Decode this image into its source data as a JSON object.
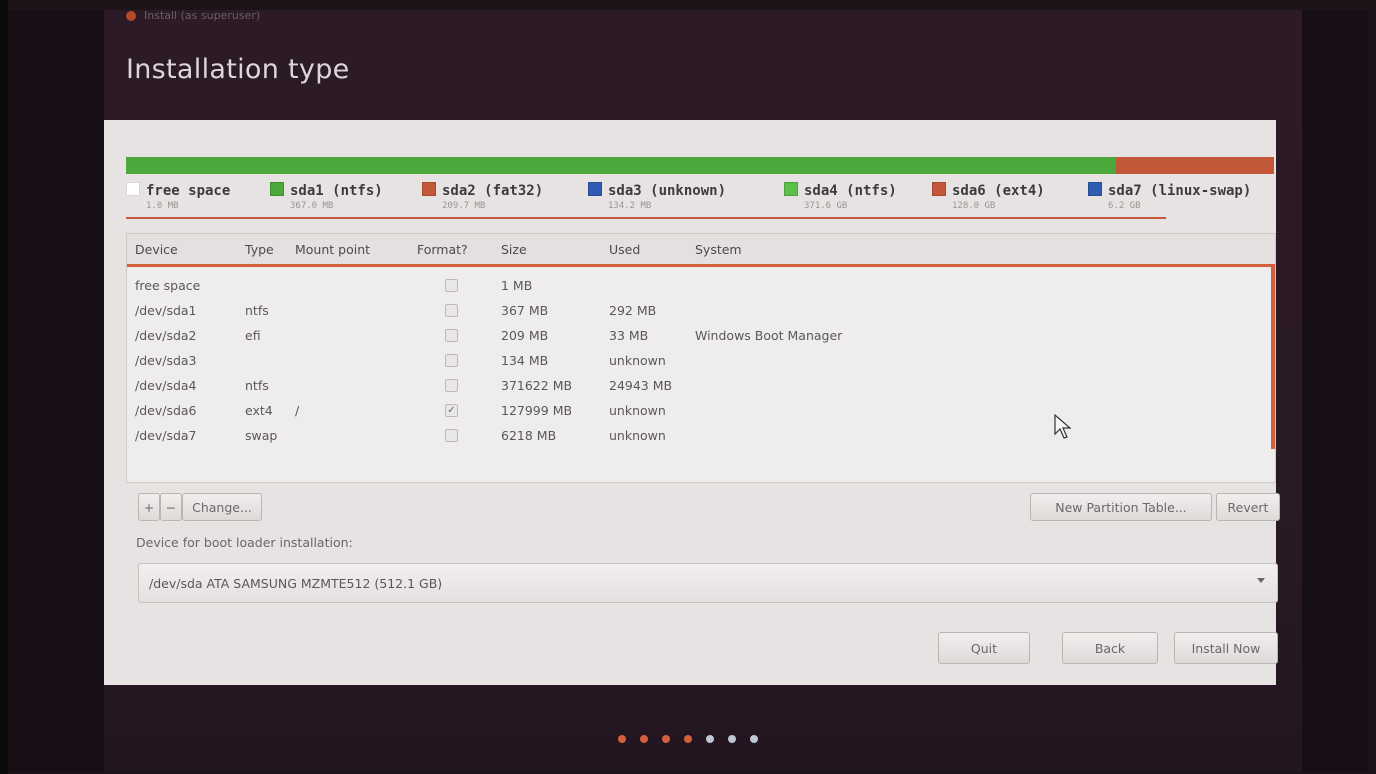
{
  "window": {
    "title": "Install (as superuser)"
  },
  "page": {
    "title": "Installation type"
  },
  "usage_bar": {
    "segments": [
      {
        "name": "sda1",
        "color": "#4aa93a",
        "share": 0.001
      },
      {
        "name": "sda2",
        "color": "#4aa93a",
        "share": 0.001
      },
      {
        "name": "sda4",
        "color": "#4aa93a",
        "share": 0.86
      },
      {
        "name": "sda6",
        "color": "#c4583a",
        "share": 0.128
      },
      {
        "name": "sda7",
        "color": "#c4583a",
        "share": 0.01
      }
    ]
  },
  "legend": [
    {
      "label": "free space",
      "size": "1.0 MB",
      "color": "#ffffff"
    },
    {
      "label": "sda1 (ntfs)",
      "size": "367.0 MB",
      "color": "#4aa93a"
    },
    {
      "label": "sda2 (fat32)",
      "size": "209.7 MB",
      "color": "#c4583a"
    },
    {
      "label": "sda3 (unknown)",
      "size": "134.2 MB",
      "color": "#2f5bb0"
    },
    {
      "label": "sda4 (ntfs)",
      "size": "371.6 GB",
      "color": "#5ac04a"
    },
    {
      "label": "sda6 (ext4)",
      "size": "128.0 GB",
      "color": "#c4583a"
    },
    {
      "label": "sda7 (linux-swap)",
      "size": "6.2 GB",
      "color": "#2f5bb0"
    }
  ],
  "table": {
    "headers": {
      "device": "Device",
      "type": "Type",
      "mount": "Mount point",
      "format": "Format?",
      "size": "Size",
      "used": "Used",
      "system": "System"
    },
    "rows": [
      {
        "device": "free space",
        "type": "",
        "mount": "",
        "format": false,
        "size": "1 MB",
        "used": "",
        "system": ""
      },
      {
        "device": "/dev/sda1",
        "type": "ntfs",
        "mount": "",
        "format": false,
        "size": "367 MB",
        "used": "292 MB",
        "system": ""
      },
      {
        "device": "/dev/sda2",
        "type": "efi",
        "mount": "",
        "format": false,
        "size": "209 MB",
        "used": "33 MB",
        "system": "Windows Boot Manager"
      },
      {
        "device": "/dev/sda3",
        "type": "",
        "mount": "",
        "format": false,
        "size": "134 MB",
        "used": "unknown",
        "system": ""
      },
      {
        "device": "/dev/sda4",
        "type": "ntfs",
        "mount": "",
        "format": false,
        "size": "371622 MB",
        "used": "24943 MB",
        "system": ""
      },
      {
        "device": "/dev/sda6",
        "type": "ext4",
        "mount": "/",
        "format": true,
        "size": "127999 MB",
        "used": "unknown",
        "system": ""
      },
      {
        "device": "/dev/sda7",
        "type": "swap",
        "mount": "",
        "format": false,
        "size": "6218 MB",
        "used": "unknown",
        "system": ""
      }
    ]
  },
  "buttons": {
    "add": "+",
    "remove": "−",
    "change": "Change...",
    "new_partition_table": "New Partition Table...",
    "revert": "Revert",
    "quit": "Quit",
    "back": "Back",
    "install_now": "Install Now"
  },
  "bootloader": {
    "label": "Device for boot loader installation:",
    "selected": "/dev/sda   ATA SAMSUNG MZMTE512 (512.1 GB)"
  },
  "pager": {
    "dots": [
      "#d35e3c",
      "#d35e3c",
      "#d35e3c",
      "#d35e3c",
      "#bfc7d6",
      "#bfc7d6",
      "#bfc7d6"
    ]
  }
}
